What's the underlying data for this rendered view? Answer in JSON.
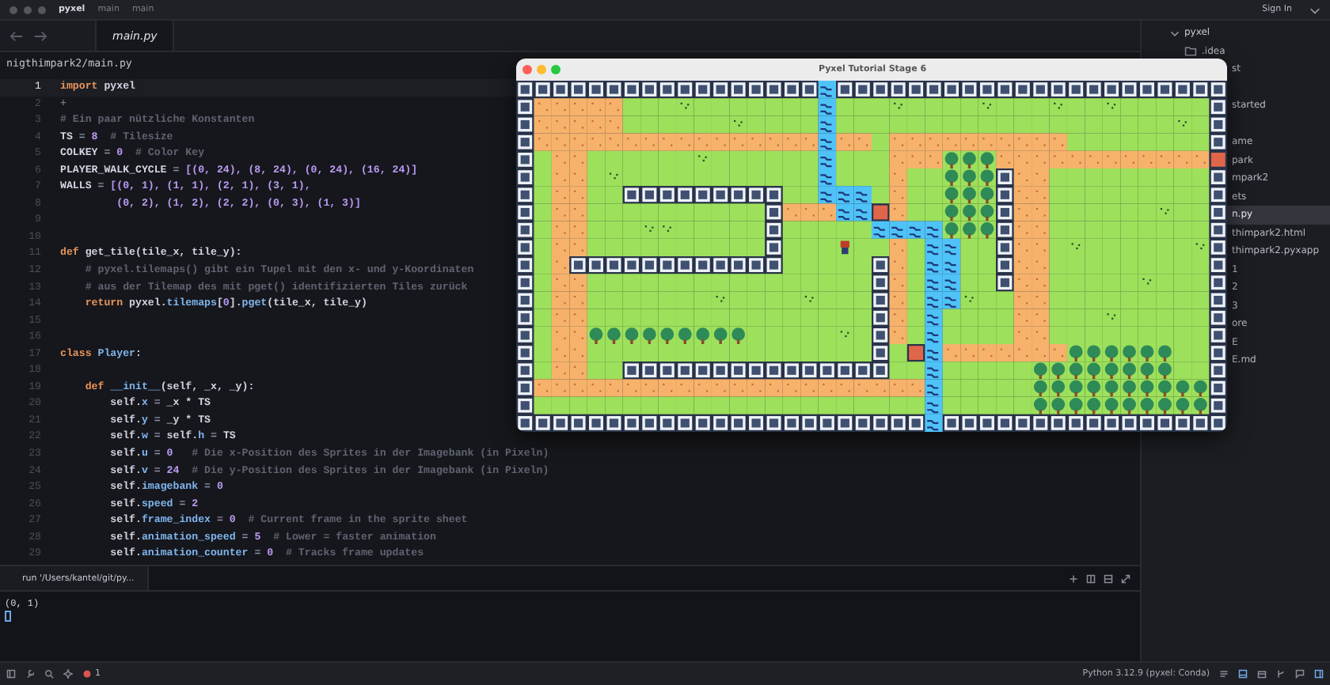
{
  "titlebar": {
    "project": "pyxel",
    "branch": "main",
    "worktree": "main",
    "sign_in": "Sign In"
  },
  "tabs": [
    {
      "label": "main.py",
      "selected": true
    }
  ],
  "breadcrumb": "nigthimpark2/main.py",
  "editor": {
    "lines": [
      {
        "number": "1",
        "current": true,
        "tokens": [
          {
            "kind": "keyword",
            "text": "import"
          },
          {
            "kind": "plain",
            "text": " pyxel"
          }
        ]
      },
      {
        "number": "2",
        "current": false,
        "tokens": [
          {
            "kind": "hint",
            "text": "+"
          }
        ]
      },
      {
        "number": "3",
        "current": false,
        "tokens": [
          {
            "kind": "comment",
            "text": "# Ein paar nützliche Konstanten"
          }
        ]
      },
      {
        "number": "4",
        "current": false,
        "tokens": [
          {
            "kind": "plain",
            "text": "TS "
          },
          {
            "kind": "operator",
            "text": "="
          },
          {
            "kind": "number",
            "text": " 8"
          },
          {
            "kind": "comment",
            "text": "  # Tilesize"
          }
        ]
      },
      {
        "number": "5",
        "current": false,
        "tokens": [
          {
            "kind": "plain",
            "text": "COLKEY "
          },
          {
            "kind": "operator",
            "text": "="
          },
          {
            "kind": "number",
            "text": " 0"
          },
          {
            "kind": "comment",
            "text": "  # Color Key"
          }
        ]
      },
      {
        "number": "6",
        "current": false,
        "tokens": [
          {
            "kind": "plain",
            "text": "PLAYER_WALK_CYCLE "
          },
          {
            "kind": "operator",
            "text": "="
          },
          {
            "kind": "number",
            "text": " [(0, 24), (8, 24), (0, 24), (16, 24)]"
          }
        ]
      },
      {
        "number": "7",
        "current": false,
        "tokens": [
          {
            "kind": "plain",
            "text": "WALLS "
          },
          {
            "kind": "operator",
            "text": "="
          },
          {
            "kind": "number",
            "text": " [(0, 1), (1, 1), (2, 1), (3, 1),"
          }
        ]
      },
      {
        "number": "8",
        "current": false,
        "tokens": [
          {
            "kind": "number",
            "text": "         (0, 2), (1, 2), (2, 2), (0, 3), (1, 3)]"
          }
        ]
      },
      {
        "number": "9",
        "current": false
      },
      {
        "number": "10",
        "current": false
      },
      {
        "number": "11",
        "current": false,
        "tokens": [
          {
            "kind": "keyword",
            "text": "def"
          },
          {
            "kind": "plain",
            "text": " get_tile(tile_x, tile_y):"
          }
        ]
      },
      {
        "number": "12",
        "current": false,
        "tokens": [
          {
            "kind": "comment",
            "text": "    # pyxel.tilemaps() gibt ein Tupel mit den x- und y-Koordinaten"
          }
        ]
      },
      {
        "number": "13",
        "current": false,
        "tokens": [
          {
            "kind": "comment",
            "text": "    # aus der Tilemap des mit pget() identifizierten Tiles zurück"
          }
        ]
      },
      {
        "number": "14",
        "current": false,
        "tokens": [
          {
            "kind": "keyword",
            "text": "    return"
          },
          {
            "kind": "plain",
            "text": " pyxel."
          },
          {
            "kind": "attribute",
            "text": "tilemaps"
          },
          {
            "kind": "plain",
            "text": "["
          },
          {
            "kind": "number",
            "text": "0"
          },
          {
            "kind": "plain",
            "text": "]."
          },
          {
            "kind": "attribute",
            "text": "pget"
          },
          {
            "kind": "plain",
            "text": "(tile_x, tile_y)"
          }
        ]
      },
      {
        "number": "15",
        "current": false
      },
      {
        "number": "16",
        "current": false
      },
      {
        "number": "17",
        "current": false,
        "tokens": [
          {
            "kind": "keyword",
            "text": "class"
          },
          {
            "kind": "attribute",
            "text": " Player"
          },
          {
            "kind": "plain",
            "text": ":"
          }
        ]
      },
      {
        "number": "18",
        "current": false
      },
      {
        "number": "19",
        "current": false,
        "tokens": [
          {
            "kind": "keyword",
            "text": "    def"
          },
          {
            "kind": "attribute",
            "text": " __init__"
          },
          {
            "kind": "plain",
            "text": "(self, _x, _y):"
          }
        ]
      },
      {
        "number": "20",
        "current": false,
        "tokens": [
          {
            "kind": "plain",
            "text": "        self."
          },
          {
            "kind": "attribute",
            "text": "x"
          },
          {
            "kind": "operator",
            "text": " ="
          },
          {
            "kind": "plain",
            "text": " _x * TS"
          }
        ]
      },
      {
        "number": "21",
        "current": false,
        "tokens": [
          {
            "kind": "plain",
            "text": "        self."
          },
          {
            "kind": "attribute",
            "text": "y"
          },
          {
            "kind": "operator",
            "text": " ="
          },
          {
            "kind": "plain",
            "text": " _y * TS"
          }
        ]
      },
      {
        "number": "22",
        "current": false,
        "tokens": [
          {
            "kind": "plain",
            "text": "        self."
          },
          {
            "kind": "attribute",
            "text": "w"
          },
          {
            "kind": "operator",
            "text": " ="
          },
          {
            "kind": "plain",
            "text": " self."
          },
          {
            "kind": "attribute",
            "text": "h"
          },
          {
            "kind": "operator",
            "text": " ="
          },
          {
            "kind": "plain",
            "text": " TS"
          }
        ]
      },
      {
        "number": "23",
        "current": false,
        "tokens": [
          {
            "kind": "plain",
            "text": "        self."
          },
          {
            "kind": "attribute",
            "text": "u"
          },
          {
            "kind": "operator",
            "text": " ="
          },
          {
            "kind": "number",
            "text": " 0"
          },
          {
            "kind": "comment",
            "text": "   # Die x-Position des Sprites in der Imagebank (in Pixeln)"
          }
        ]
      },
      {
        "number": "24",
        "current": false,
        "tokens": [
          {
            "kind": "plain",
            "text": "        self."
          },
          {
            "kind": "attribute",
            "text": "v"
          },
          {
            "kind": "operator",
            "text": " ="
          },
          {
            "kind": "number",
            "text": " 24"
          },
          {
            "kind": "comment",
            "text": "  # Die y-Position des Sprites in der Imagebank (in Pixeln)"
          }
        ]
      },
      {
        "number": "25",
        "current": false,
        "tokens": [
          {
            "kind": "plain",
            "text": "        self."
          },
          {
            "kind": "attribute",
            "text": "imagebank"
          },
          {
            "kind": "operator",
            "text": " ="
          },
          {
            "kind": "number",
            "text": " 0"
          }
        ]
      },
      {
        "number": "26",
        "current": false,
        "tokens": [
          {
            "kind": "plain",
            "text": "        self."
          },
          {
            "kind": "attribute",
            "text": "speed"
          },
          {
            "kind": "operator",
            "text": " ="
          },
          {
            "kind": "number",
            "text": " 2"
          }
        ]
      },
      {
        "number": "27",
        "current": false,
        "tokens": [
          {
            "kind": "plain",
            "text": "        self."
          },
          {
            "kind": "attribute",
            "text": "frame_index"
          },
          {
            "kind": "operator",
            "text": " ="
          },
          {
            "kind": "number",
            "text": " 0"
          },
          {
            "kind": "comment",
            "text": "  # Current frame in the sprite sheet"
          }
        ]
      },
      {
        "number": "28",
        "current": false,
        "tokens": [
          {
            "kind": "plain",
            "text": "        self."
          },
          {
            "kind": "attribute",
            "text": "animation_speed"
          },
          {
            "kind": "operator",
            "text": " ="
          },
          {
            "kind": "number",
            "text": " 5"
          },
          {
            "kind": "comment",
            "text": "  # Lower = faster animation"
          }
        ]
      },
      {
        "number": "29",
        "current": false,
        "tokens": [
          {
            "kind": "plain",
            "text": "        self."
          },
          {
            "kind": "attribute",
            "text": "animation_counter"
          },
          {
            "kind": "operator",
            "text": " ="
          },
          {
            "kind": "number",
            "text": " 0"
          },
          {
            "kind": "comment",
            "text": "  # Tracks frame updates"
          }
        ]
      }
    ]
  },
  "sidebar": {
    "root": {
      "label": "pyxel",
      "expanded": true,
      "children": [
        {
          "kind": "folder",
          "label": ".idea",
          "selected": false
        },
        {
          "kind": "file",
          "label": "st",
          "selected": false
        },
        {
          "kind": "covered",
          "selected": false
        },
        {
          "kind": "file",
          "label": "started",
          "selected": false
        },
        {
          "kind": "covered",
          "selected": false
        },
        {
          "kind": "file",
          "label": "ame",
          "selected": false
        },
        {
          "kind": "file",
          "label": "park",
          "selected": false
        },
        {
          "kind": "file",
          "label": "mpark2",
          "selected": false
        },
        {
          "kind": "file",
          "label": "ets",
          "selected": false
        },
        {
          "kind": "file",
          "label": "n.py",
          "selected": true
        },
        {
          "kind": "file",
          "label": "thimpark2.html",
          "selected": false
        },
        {
          "kind": "file",
          "label": "thimpark2.pyxapp",
          "selected": false
        },
        {
          "kind": "file",
          "label": "1",
          "selected": false
        },
        {
          "kind": "file",
          "label": "2",
          "selected": false
        },
        {
          "kind": "file",
          "label": "3",
          "selected": false
        },
        {
          "kind": "file",
          "label": "ore",
          "selected": false
        },
        {
          "kind": "file",
          "label": "E",
          "selected": false
        },
        {
          "kind": "file",
          "label": "E.md",
          "selected": false
        }
      ]
    }
  },
  "game_window": {
    "title": "Pyxel Tutorial Stage 6"
  },
  "terminal": {
    "tab": "run '/Users/kantel/git/py...",
    "output": [
      "(0, 1)"
    ]
  },
  "status_bar": {
    "errors": "1",
    "interpreter": "Python 3.12.9 (pyxel: Conda)"
  }
}
